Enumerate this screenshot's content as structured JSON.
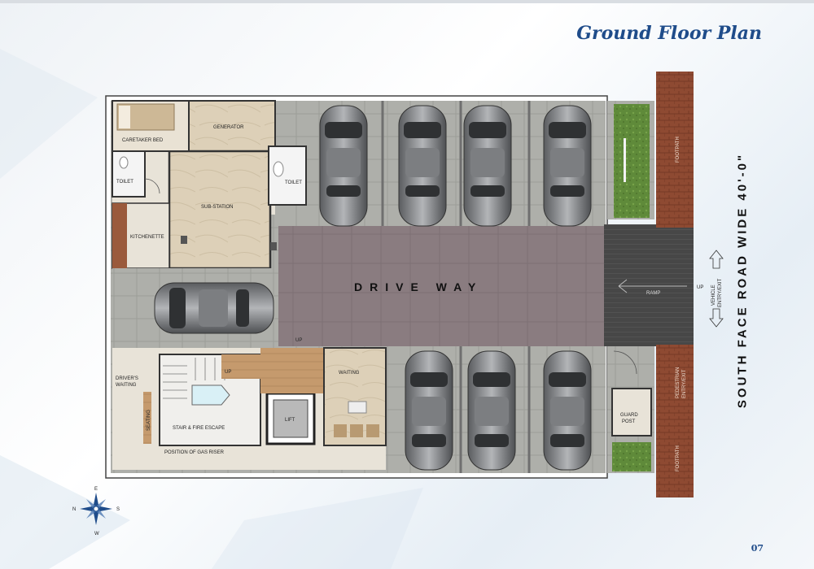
{
  "title": "Ground Floor Plan",
  "page_number": "07",
  "road_label": "SOUTH FACE ROAD WIDE 40'-0\"",
  "rooms": {
    "caretaker_bed": "CARETAKER BED",
    "generator": "GENERATOR",
    "toilet_left": "TOILET",
    "toilet_right": "TOILET",
    "sub_station": "SUB-STATION",
    "kitchenette": "KITCHENETTE",
    "drive_way": "DRIVE WAY",
    "up_drive": "UP",
    "up_stair": "UP",
    "up_ramp": "UP",
    "ramp": "RAMP",
    "drivers_waiting_1": "DRIVER'S",
    "drivers_waiting_2": "WAITING",
    "seating": "SEATING",
    "stair_fire_escape": "STAIR & FIRE ESCAPE",
    "gas_riser": "POSITION OF GAS RISER",
    "lift": "LIFT",
    "waiting": "WAITING",
    "guard_post_1": "GUARD",
    "guard_post_2": "POST",
    "footpath_top": "FOOTPATH",
    "footpath_bottom": "FOOTPATH",
    "pedestrian_1": "PEDESTRIAN",
    "pedestrian_2": "ENTRY/EXIT",
    "vehicle_1": "VEHICLE",
    "vehicle_2": "ENTRY/EXIT"
  },
  "compass": {
    "n": "N",
    "e": "E",
    "s": "S",
    "w": "W"
  },
  "colors": {
    "title": "#1f4c8a",
    "driveway": "#8a7c80",
    "parking_tile": "#a9aaa5",
    "service_floor": "#ddd0b8",
    "garden": "#5f8a3a",
    "brick": "#8e4a32",
    "ramp": "#474747"
  }
}
